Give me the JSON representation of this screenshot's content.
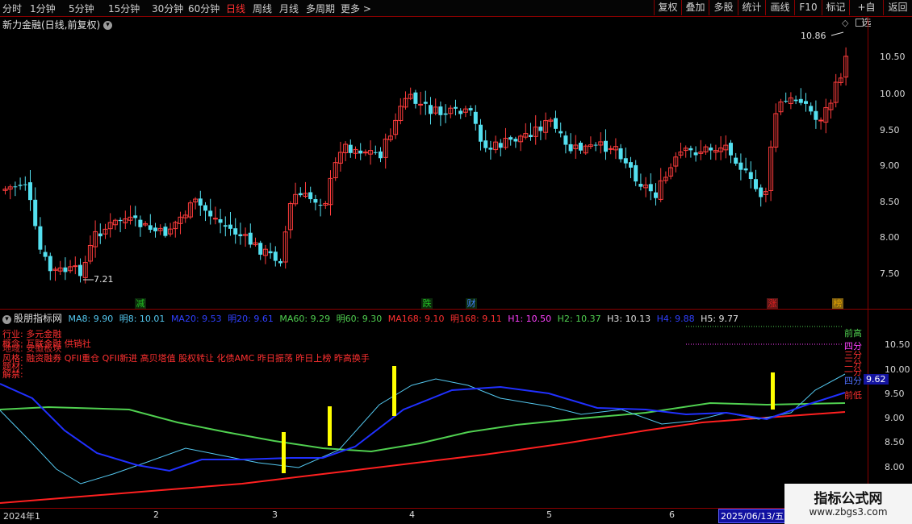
{
  "toolbar": {
    "periods": [
      "分时",
      "1分钟",
      "5分钟",
      "15分钟",
      "30分钟",
      "60分钟",
      "日线",
      "周线",
      "月线",
      "多周期",
      "更多"
    ],
    "active_period": "日线",
    "more_arrow": ">",
    "right_buttons": [
      "复权",
      "叠加",
      "多股",
      "统计",
      "画线",
      "F10",
      "标记",
      "+自选",
      "返回"
    ]
  },
  "main_chart": {
    "title": "新力金融(日线,前复权)",
    "price_ticks": [
      "10.50",
      "10.00",
      "9.50",
      "9.00",
      "8.50",
      "8.00",
      "7.50"
    ],
    "high_label": "10.86",
    "low_label": "7.21",
    "event_markers": [
      {
        "label": "减",
        "color": "#22c022"
      },
      {
        "label": "跌",
        "color": "#22c022"
      },
      {
        "label": "财",
        "color": "#4080ff"
      },
      {
        "label": "涨",
        "color": "#e02020"
      },
      {
        "label": "榜",
        "color": "#e0a000"
      }
    ],
    "colors": {
      "up": "#ff3c3c",
      "down": "#54e0f0"
    }
  },
  "indicator": {
    "name": "股朋指标网",
    "legend": [
      {
        "text": "MA8: 9.90",
        "color": "#54c8f0"
      },
      {
        "text": "明8: 10.01",
        "color": "#54c8f0"
      },
      {
        "text": "MA20: 9.53",
        "color": "#3040ff"
      },
      {
        "text": "明20: 9.61",
        "color": "#3040ff"
      },
      {
        "text": "MA60: 9.29",
        "color": "#50d050"
      },
      {
        "text": "明60: 9.30",
        "color": "#50d050"
      },
      {
        "text": "MA168: 9.10",
        "color": "#ff3030"
      },
      {
        "text": "明168: 9.11",
        "color": "#ff3030"
      },
      {
        "text": "H1: 10.50",
        "color": "#ff40ff"
      },
      {
        "text": "H2: 10.37",
        "color": "#50d050"
      },
      {
        "text": "H3: 10.13",
        "color": "#e0e0e0"
      },
      {
        "text": "H4: 9.88",
        "color": "#3040ff"
      },
      {
        "text": "H5: 9.77",
        "color": "#e0e0e0"
      }
    ],
    "info_lines": [
      "行业: 多元金融",
      "概念: 互联金融 供销社",
      "地域: 安徽板块",
      "风格: 融资融券 QFII重仓 QFII新进 高贝塔值 股权转让 化债AMC 昨日振荡 昨日上榜 昨高换手",
      "题材:",
      "解禁:"
    ],
    "right_ticks": [
      "10.50",
      "10.00",
      "9.50",
      "9.00",
      "8.50",
      "8.00"
    ],
    "right_labels": [
      {
        "text": "前高",
        "color": "#50d050"
      },
      {
        "text": "四分",
        "color": "#ff40ff"
      },
      {
        "text": "三分",
        "color": "#ff3030"
      },
      {
        "text": "二分",
        "color": "#ff3030"
      },
      {
        "text": "一分",
        "color": "#ff3030"
      },
      {
        "text": "四分",
        "color": "#5070ff"
      },
      {
        "text": "前低",
        "color": "#ff3030"
      }
    ],
    "current_value": "9.62"
  },
  "date_axis": {
    "labels": [
      "2024年1",
      "2",
      "3",
      "4",
      "5",
      "6"
    ],
    "selected": "2025/06/13/五"
  },
  "watermark": {
    "title": "指标公式网",
    "url": "www.zbgs3.com"
  }
}
